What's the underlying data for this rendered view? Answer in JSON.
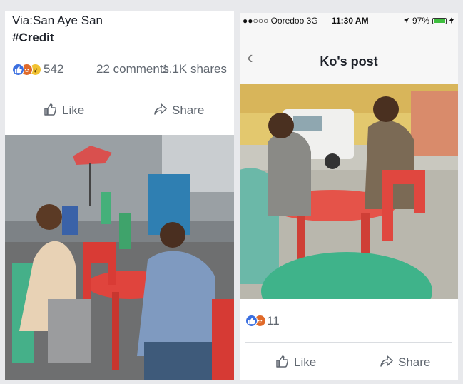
{
  "left_post": {
    "via_text": "Via:San Aye San",
    "hashtag": "#Credit",
    "reaction_count": "542",
    "comments": "22 comments",
    "shares": "1.1K shares",
    "like_label": "Like",
    "share_label": "Share",
    "reaction_icons": [
      "like-reaction-icon",
      "angry-reaction-icon",
      "wow-reaction-icon"
    ]
  },
  "right_post": {
    "status": {
      "carrier": "●●○○○ Ooredoo  3G",
      "time": "11:30 AM",
      "battery": "97%",
      "battery_level": 0.97
    },
    "nav_title": "Ko's post",
    "reaction_count": "11",
    "like_label": "Like",
    "share_label": "Share",
    "reaction_icons": [
      "like-reaction-icon",
      "angry-reaction-icon"
    ]
  },
  "colors": {
    "fb_blue": "#3b6fe0",
    "angry": "#e06a2a",
    "wow": "#f1c232",
    "text_secondary": "#606770",
    "battery_green": "#3fbf3f"
  }
}
